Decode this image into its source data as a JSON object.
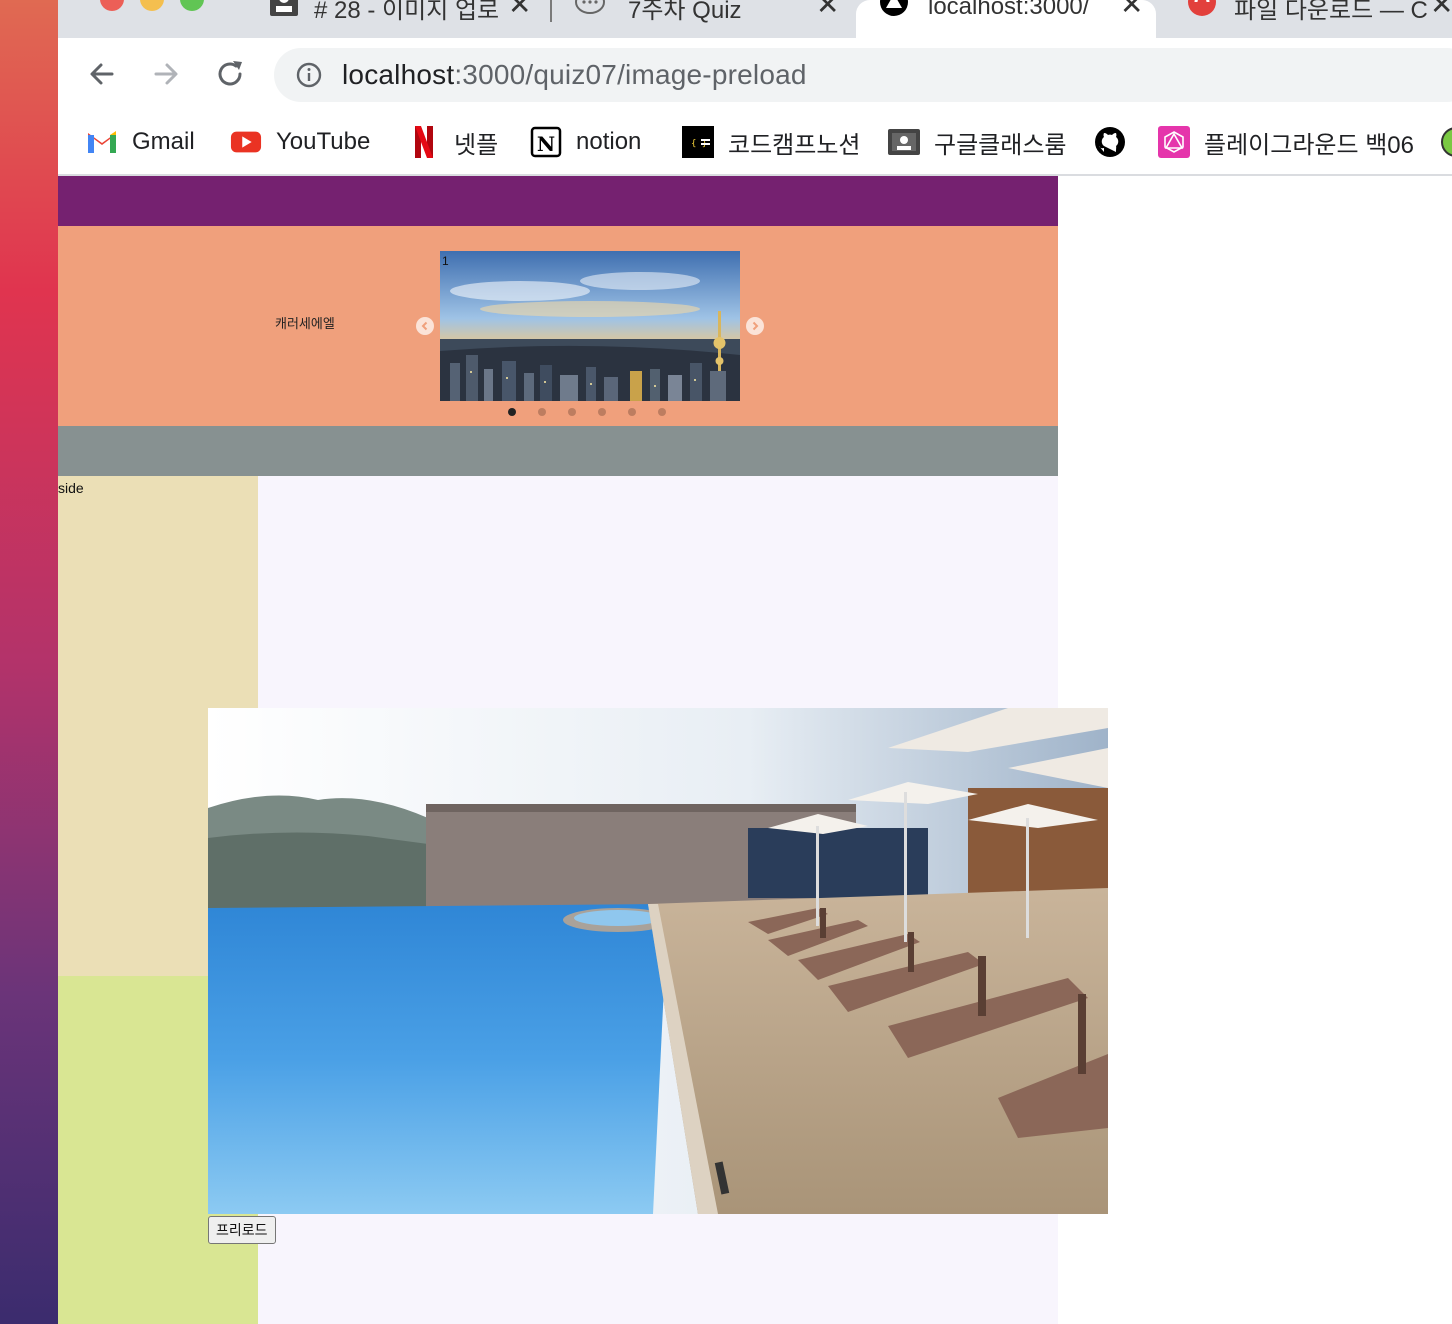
{
  "tabs": [
    {
      "title": "# 28 - 이미지 업로",
      "active": false
    },
    {
      "title": "7주차 Quiz",
      "active": false
    },
    {
      "title": "localhost:3000/",
      "active": true
    },
    {
      "title": "파일 다운로드 — C",
      "active": false
    }
  ],
  "omnibox": {
    "host": "localhost",
    "path": ":3000/quiz07/image-preload"
  },
  "bookmarks": [
    {
      "label": "Gmail",
      "icon": "gmail-icon"
    },
    {
      "label": "YouTube",
      "icon": "youtube-icon"
    },
    {
      "label": "넷플",
      "icon": "netflix-icon"
    },
    {
      "label": "notion",
      "icon": "notion-icon"
    },
    {
      "label": "코드캠프노션",
      "icon": "codecamp-icon"
    },
    {
      "label": "구글클래스룸",
      "icon": "classroom-icon"
    },
    {
      "label": "",
      "icon": "github-icon"
    },
    {
      "label": "플레이그라운드 백06",
      "icon": "graphql-icon"
    }
  ],
  "page": {
    "banner_label": "캐러세에엘",
    "slide_number": "1",
    "carousel_dots": 6,
    "carousel_active_dot": 0,
    "side_label": "side",
    "preload_button": "프리로드"
  },
  "colors": {
    "header": "#752170",
    "banner": "#f0a07c",
    "navigation": "#879191",
    "side": "#ebdfb6",
    "side_lower": "#d9e693",
    "main": "#f8f5fd"
  }
}
